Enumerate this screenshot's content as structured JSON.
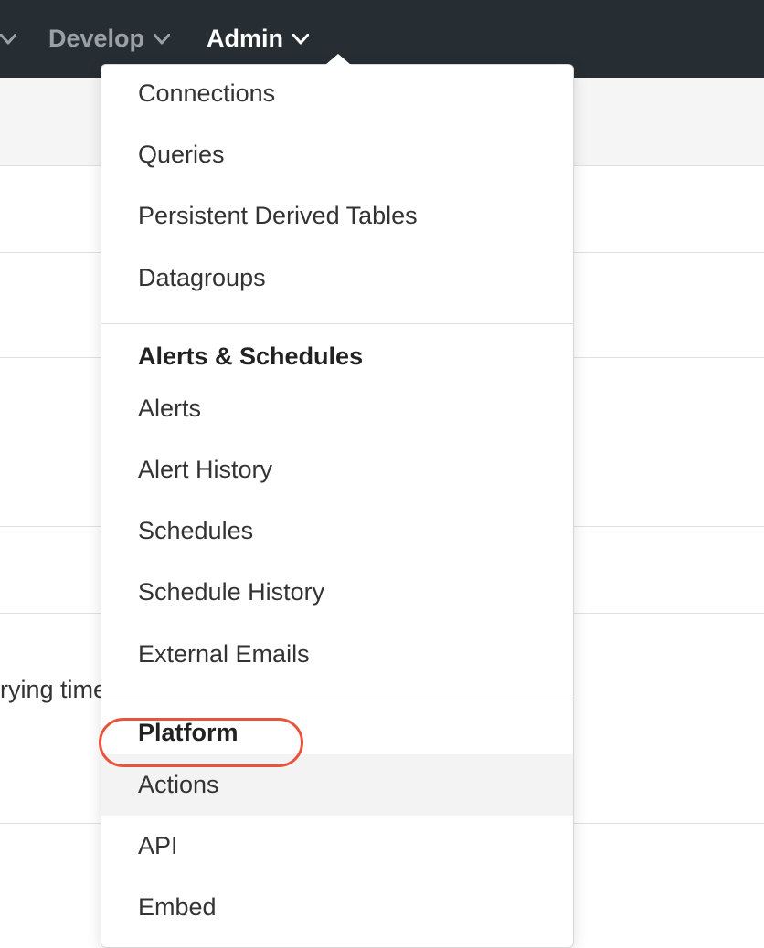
{
  "topnav": {
    "develop_label": "Develop",
    "admin_label": "Admin"
  },
  "background": {
    "partial_text": "rying time"
  },
  "menu": {
    "database_section": {
      "items": [
        "Connections",
        "Queries",
        "Persistent Derived Tables",
        "Datagroups"
      ]
    },
    "alerts_section": {
      "header": "Alerts & Schedules",
      "items": [
        "Alerts",
        "Alert History",
        "Schedules",
        "Schedule History",
        "External Emails"
      ]
    },
    "platform_section": {
      "header": "Platform",
      "items": [
        "Actions",
        "API",
        "Embed"
      ]
    }
  }
}
